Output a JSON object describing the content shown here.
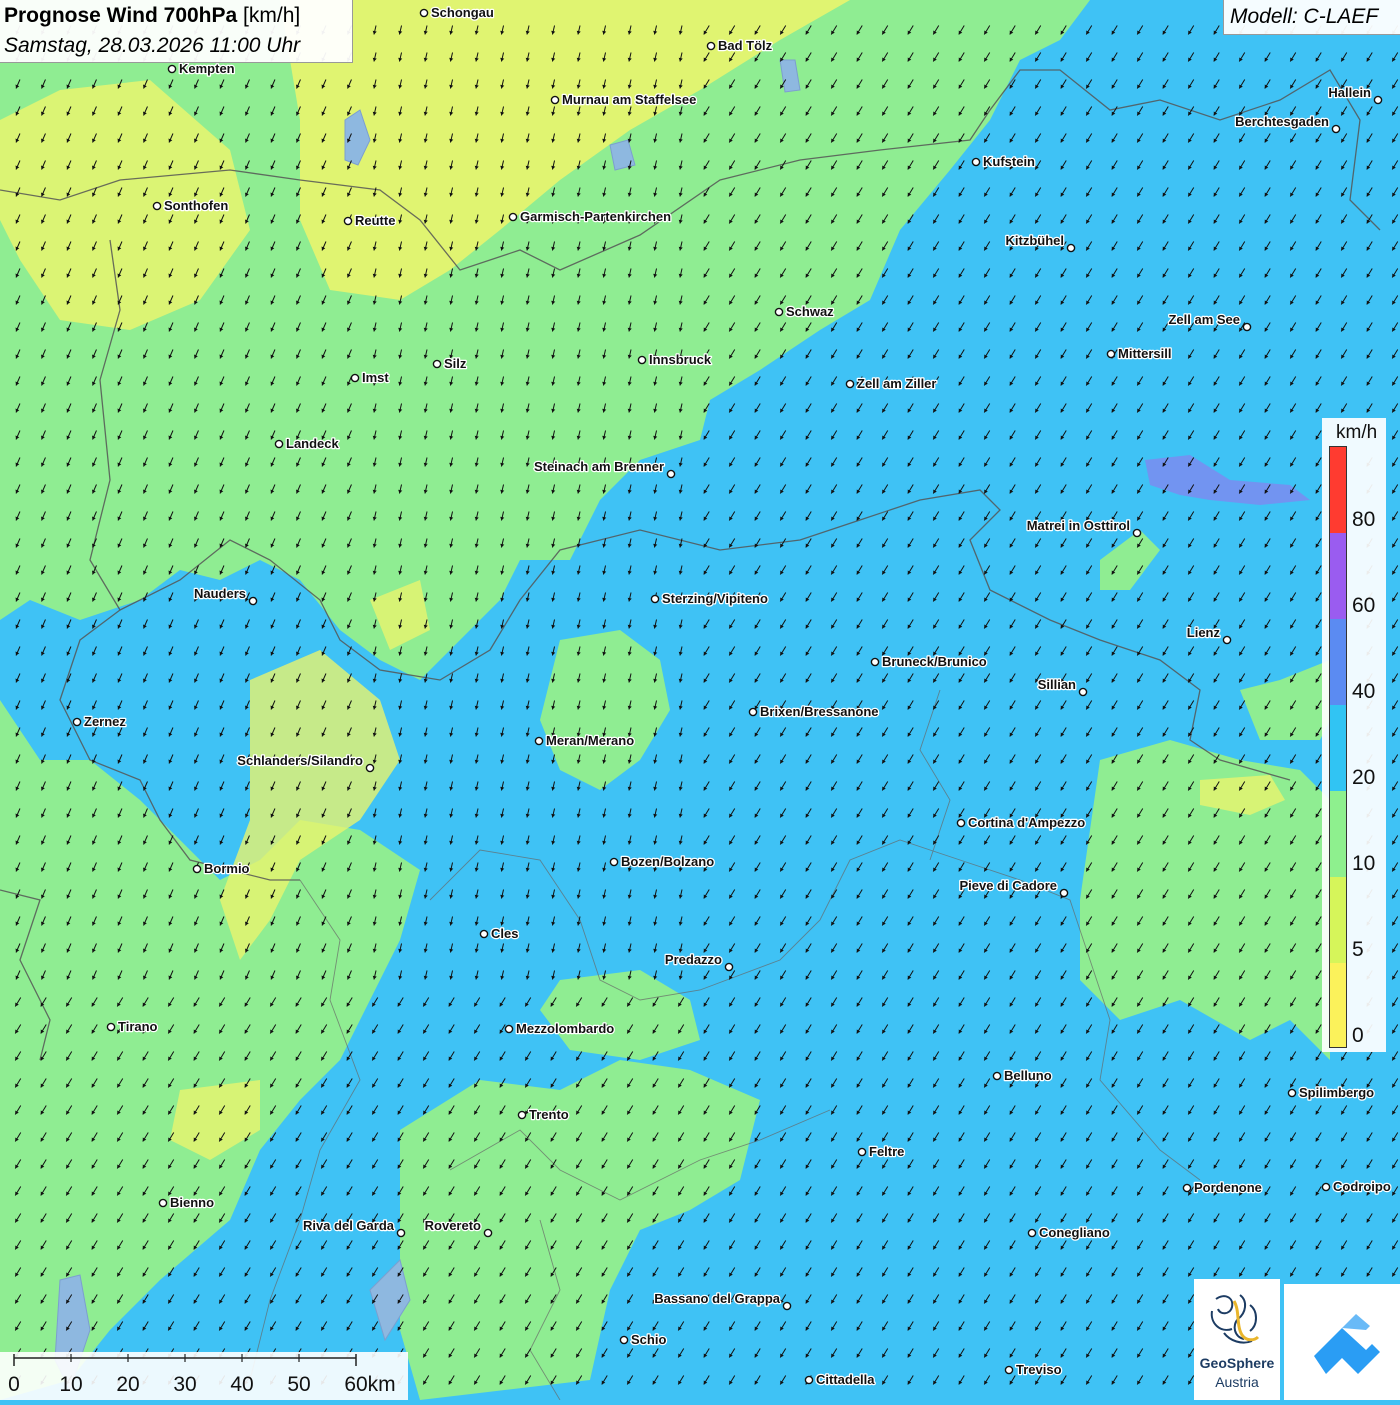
{
  "header": {
    "title_main": "Prognose Wind 700hPa",
    "title_unit": "[km/h]",
    "datetime": "Samstag, 28.03.2026 11:00 Uhr",
    "model": "Modell: C-LAEF"
  },
  "legend": {
    "unit": "km/h",
    "ticks": [
      "80",
      "60",
      "40",
      "20",
      "10",
      "5",
      "0"
    ],
    "colors": [
      "#ff3b30",
      "#9a5cf0",
      "#5b8bf2",
      "#31c4f3",
      "#8ef08e",
      "#d6f55a",
      "#fbf25b"
    ]
  },
  "scale_bar": {
    "labels": [
      "0",
      "10",
      "20",
      "30",
      "40",
      "50",
      "60km"
    ]
  },
  "places": [
    {
      "name": "Schongau",
      "dot": "left"
    },
    {
      "name": "Bad Tölz",
      "dot": "left"
    },
    {
      "name": "Kempten",
      "dot": "left"
    },
    {
      "name": "Murnau am Staffelsee",
      "dot": "left"
    },
    {
      "name": "Hallein",
      "dot": "right"
    },
    {
      "name": "Berchtesgaden",
      "dot": "right"
    },
    {
      "name": "Kufstein",
      "dot": "left"
    },
    {
      "name": "Sonthofen",
      "dot": "left"
    },
    {
      "name": "Reutte",
      "dot": "left"
    },
    {
      "name": "Garmisch-Partenkirchen",
      "dot": "left"
    },
    {
      "name": "Kitzbühel",
      "dot": "right"
    },
    {
      "name": "Schwaz",
      "dot": "left"
    },
    {
      "name": "Zell am See",
      "dot": "right"
    },
    {
      "name": "Mittersill",
      "dot": "left"
    },
    {
      "name": "Silz",
      "dot": "left"
    },
    {
      "name": "Innsbruck",
      "dot": "left"
    },
    {
      "name": "Imst",
      "dot": "left"
    },
    {
      "name": "Zell am Ziller",
      "dot": "left"
    },
    {
      "name": "Landeck",
      "dot": "left"
    },
    {
      "name": "Steinach am Brenner",
      "dot": "right"
    },
    {
      "name": "Matrei in Osttirol",
      "dot": "right"
    },
    {
      "name": "Nauders",
      "dot": "right"
    },
    {
      "name": "Sterzing/Vipiteno",
      "dot": "left"
    },
    {
      "name": "Lienz",
      "dot": "right"
    },
    {
      "name": "Bruneck/Brunico",
      "dot": "left"
    },
    {
      "name": "Sillian",
      "dot": "right"
    },
    {
      "name": "Zernez",
      "dot": "left"
    },
    {
      "name": "Brixen/Bressanone",
      "dot": "left"
    },
    {
      "name": "Meran/Merano",
      "dot": "left"
    },
    {
      "name": "Schlanders/Silandro",
      "dot": "right"
    },
    {
      "name": "Cortina d'Ampezzo",
      "dot": "left"
    },
    {
      "name": "Bozen/Bolzano",
      "dot": "left"
    },
    {
      "name": "Bormio",
      "dot": "left"
    },
    {
      "name": "Pieve di Cadore",
      "dot": "right"
    },
    {
      "name": "Cles",
      "dot": "left"
    },
    {
      "name": "Predazzo",
      "dot": "right"
    },
    {
      "name": "Tirano",
      "dot": "left"
    },
    {
      "name": "Mezzolombardo",
      "dot": "left"
    },
    {
      "name": "Belluno",
      "dot": "left"
    },
    {
      "name": "Spilimbergo",
      "dot": "left"
    },
    {
      "name": "Trento",
      "dot": "left"
    },
    {
      "name": "Feltre",
      "dot": "left"
    },
    {
      "name": "Pordenone",
      "dot": "left"
    },
    {
      "name": "Codroipo",
      "dot": "left"
    },
    {
      "name": "Bienno",
      "dot": "left"
    },
    {
      "name": "Riva del Garda",
      "dot": "right"
    },
    {
      "name": "Rovereto",
      "dot": "right"
    },
    {
      "name": "Conegliano",
      "dot": "left"
    },
    {
      "name": "Bassano del Grappa",
      "dot": "right"
    },
    {
      "name": "Schio",
      "dot": "left"
    },
    {
      "name": "Treviso",
      "dot": "left"
    },
    {
      "name": "Cittadella",
      "dot": "left"
    }
  ],
  "logos": {
    "geosphere_line1": "GeoSphere",
    "geosphere_line2": "Austria"
  }
}
